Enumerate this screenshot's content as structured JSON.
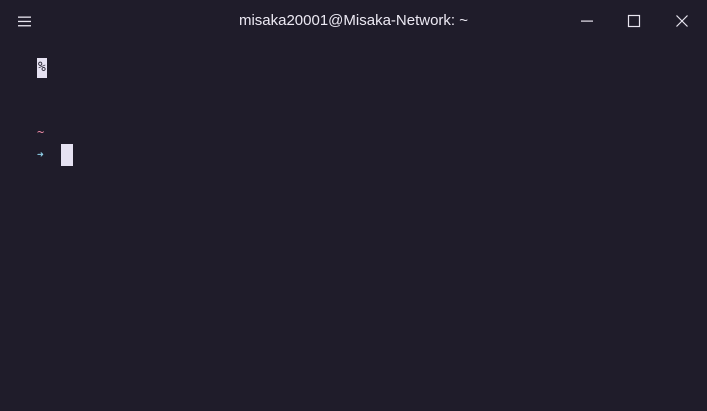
{
  "window": {
    "title": "misaka20001@Misaka-Network: ~"
  },
  "icons": {
    "menu": "hamburger-menu-icon",
    "minimize": "minimize-icon",
    "maximize": "maximize-icon",
    "close": "close-icon"
  },
  "terminal": {
    "partial_line_marker": "%",
    "prompt_cwd": "~",
    "prompt_symbol": "➜",
    "input": ""
  },
  "colors": {
    "background": "#1f1c2a",
    "cwd": "#f08ca8",
    "prompt_arrow": "#8fd0e8",
    "cursor": "#e6e2f2"
  }
}
